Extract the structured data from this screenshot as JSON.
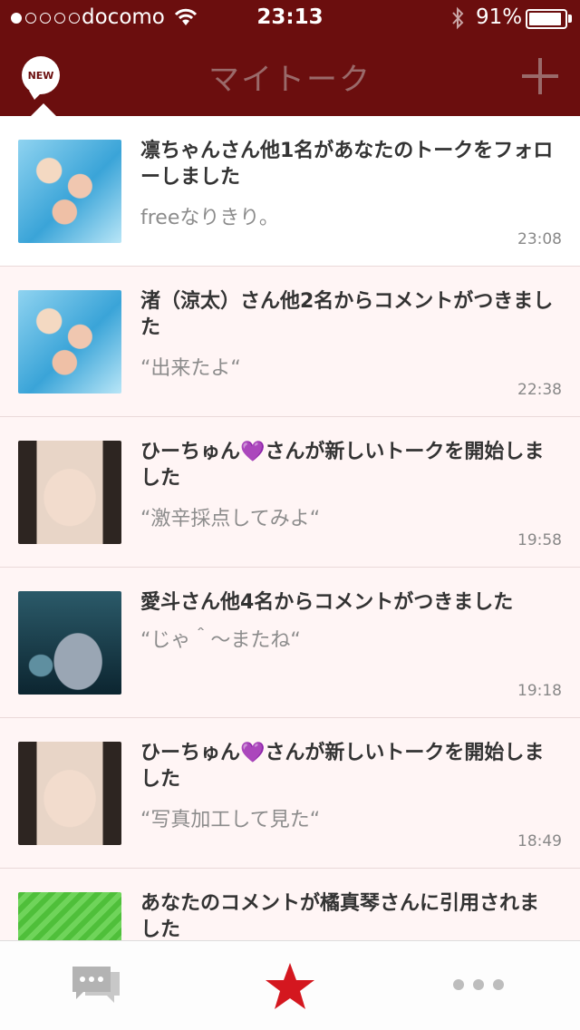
{
  "status_bar": {
    "carrier": "docomo",
    "time": "23:13",
    "battery": "91%",
    "battery_level": 0.91,
    "signal_bars_filled": 1,
    "signal_bars_total": 5
  },
  "header": {
    "title": "マイトーク",
    "new_badge": "NEW",
    "add_icon": "plus-icon"
  },
  "colors": {
    "brand_bar": "#6b0e0e",
    "active_tab": "#d4171f",
    "row_tint": "#fff5f5"
  },
  "items": [
    {
      "title": "凛ちゃんさん他1名があなたのトークをフォローしました",
      "subtitle": "freeなりきり。",
      "time": "23:08",
      "thumb": "pool-anime-thumbnail"
    },
    {
      "title": "渚（涼太）さん他2名からコメントがつきました",
      "subtitle": "“出来たよ“",
      "time": "22:38",
      "thumb": "pool-anime-thumbnail"
    },
    {
      "title_pre": "ひーちゅん",
      "heart": "💜",
      "title_post": "さんが新しいトークを開始しました",
      "subtitle": "“激辛採点してみよ“",
      "time": "19:58",
      "thumb": "face-photo-thumbnail"
    },
    {
      "title": "愛斗さん他4名からコメントがつきました",
      "subtitle": "“じゃ＾〜またね“",
      "time": "19:18",
      "thumb": "totoro-thumbnail"
    },
    {
      "title_pre": "ひーちゅん",
      "heart": "💜",
      "title_post": "さんが新しいトークを開始しました",
      "subtitle": "“写真加工して見た“",
      "time": "18:49",
      "thumb": "face-photo-thumbnail"
    },
    {
      "title": "あなたのコメントが橘真琴さんに引用されました",
      "thumb": "anime-green-thumbnail"
    }
  ],
  "tab_bar": {
    "tabs": [
      "chat-bubbles-icon",
      "star-icon",
      "more-dots-icon"
    ],
    "active": "star-icon"
  }
}
